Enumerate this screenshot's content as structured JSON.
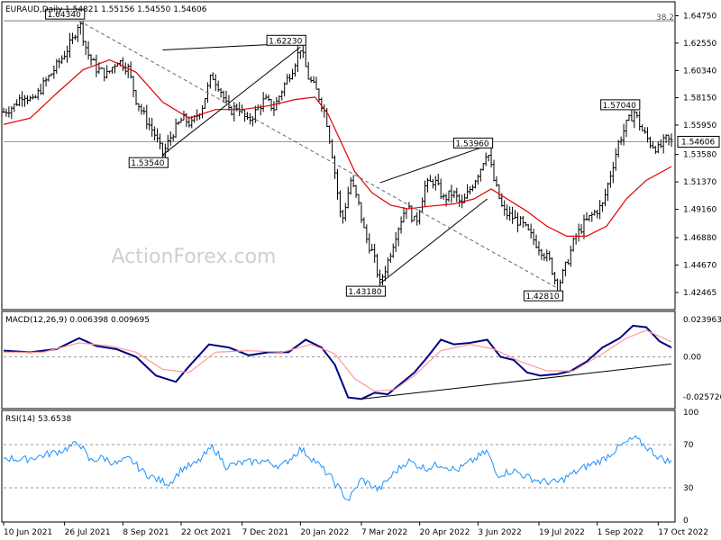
{
  "header": {
    "main_title": "EURAUD,Daily",
    "main_ohlc": "1.54821 1.55156 1.54550 1.54606",
    "macd_title": "MACD(12,26,9) 0.006398 0.009695",
    "rsi_title": "RSI(14) 53.6538",
    "watermark": "ActionForex.com",
    "fib_label": "38.2"
  },
  "colors": {
    "price": "#000000",
    "ma": "#e00000",
    "macd": "#000080",
    "signal": "#ff9999",
    "rsi": "#1e90ff",
    "dashed": "#808080",
    "watermark": "#cccccc"
  },
  "chart_data": [
    {
      "type": "ohlc",
      "panel": "price",
      "ylim": [
        1.4123,
        1.6573
      ],
      "y_ticks": [
        "1.64750",
        "1.62550",
        "1.60340",
        "1.58150",
        "1.55950",
        "1.53580",
        "1.51370",
        "1.49160",
        "1.46880",
        "1.44670",
        "1.42465"
      ],
      "current_price": "1.54606",
      "x_labels": [
        "10 Jun 2021",
        "26 Jul 2021",
        "8 Sep 2021",
        "22 Oct 2021",
        "7 Dec 2021",
        "20 Jan 2022",
        "7 Mar 2022",
        "20 Apr 2022",
        "3 Jun 2022",
        "19 Jul 2022",
        "1 Sep 2022",
        "17 Oct 2022"
      ],
      "x_label_days": [
        0,
        46,
        90,
        134,
        180,
        224,
        270,
        314,
        358,
        404,
        448,
        494
      ],
      "close_path": [
        [
          0,
          1.57
        ],
        [
          8,
          1.575
        ],
        [
          15,
          1.585
        ],
        [
          22,
          1.578
        ],
        [
          30,
          1.592
        ],
        [
          38,
          1.604
        ],
        [
          45,
          1.615
        ],
        [
          52,
          1.628
        ],
        [
          57,
          1.6434
        ],
        [
          63,
          1.618
        ],
        [
          70,
          1.605
        ],
        [
          78,
          1.6
        ],
        [
          86,
          1.612
        ],
        [
          94,
          1.605
        ],
        [
          100,
          1.58
        ],
        [
          107,
          1.565
        ],
        [
          114,
          1.552
        ],
        [
          120,
          1.5354
        ],
        [
          127,
          1.552
        ],
        [
          135,
          1.565
        ],
        [
          142,
          1.56
        ],
        [
          150,
          1.575
        ],
        [
          157,
          1.6
        ],
        [
          163,
          1.59
        ],
        [
          170,
          1.57
        ],
        [
          177,
          1.575
        ],
        [
          184,
          1.562
        ],
        [
          190,
          1.57
        ],
        [
          197,
          1.58
        ],
        [
          204,
          1.573
        ],
        [
          211,
          1.59
        ],
        [
          218,
          1.605
        ],
        [
          224,
          1.622
        ],
        [
          230,
          1.598
        ],
        [
          237,
          1.585
        ],
        [
          243,
          1.568
        ],
        [
          249,
          1.53
        ],
        [
          255,
          1.48
        ],
        [
          262,
          1.515
        ],
        [
          268,
          1.495
        ],
        [
          273,
          1.47
        ],
        [
          279,
          1.455
        ],
        [
          284,
          1.4318
        ],
        [
          290,
          1.45
        ],
        [
          297,
          1.475
        ],
        [
          304,
          1.495
        ],
        [
          311,
          1.48
        ],
        [
          318,
          1.51
        ],
        [
          325,
          1.515
        ],
        [
          332,
          1.5
        ],
        [
          339,
          1.505
        ],
        [
          346,
          1.495
        ],
        [
          353,
          1.51
        ],
        [
          360,
          1.525
        ],
        [
          365,
          1.54
        ],
        [
          370,
          1.515
        ],
        [
          377,
          1.49
        ],
        [
          384,
          1.485
        ],
        [
          391,
          1.48
        ],
        [
          398,
          1.47
        ],
        [
          405,
          1.46
        ],
        [
          412,
          1.45
        ],
        [
          418,
          1.4281
        ],
        [
          425,
          1.448
        ],
        [
          431,
          1.468
        ],
        [
          438,
          1.48
        ],
        [
          445,
          1.488
        ],
        [
          452,
          1.495
        ],
        [
          458,
          1.52
        ],
        [
          464,
          1.545
        ],
        [
          470,
          1.56
        ],
        [
          476,
          1.57
        ],
        [
          482,
          1.555
        ],
        [
          488,
          1.545
        ],
        [
          494,
          1.54
        ],
        [
          500,
          1.548
        ],
        [
          504,
          1.546
        ]
      ],
      "ma_path": [
        [
          0,
          1.56
        ],
        [
          20,
          1.565
        ],
        [
          40,
          1.585
        ],
        [
          60,
          1.604
        ],
        [
          80,
          1.612
        ],
        [
          100,
          1.602
        ],
        [
          120,
          1.578
        ],
        [
          140,
          1.565
        ],
        [
          160,
          1.572
        ],
        [
          180,
          1.572
        ],
        [
          200,
          1.575
        ],
        [
          220,
          1.58
        ],
        [
          235,
          1.582
        ],
        [
          245,
          1.568
        ],
        [
          255,
          1.545
        ],
        [
          265,
          1.522
        ],
        [
          278,
          1.505
        ],
        [
          292,
          1.495
        ],
        [
          305,
          1.492
        ],
        [
          320,
          1.494
        ],
        [
          340,
          1.496
        ],
        [
          355,
          1.5
        ],
        [
          368,
          1.508
        ],
        [
          380,
          1.5
        ],
        [
          395,
          1.49
        ],
        [
          410,
          1.478
        ],
        [
          425,
          1.47
        ],
        [
          440,
          1.47
        ],
        [
          455,
          1.478
        ],
        [
          470,
          1.5
        ],
        [
          485,
          1.515
        ],
        [
          504,
          1.526
        ]
      ],
      "levels": [
        {
          "label": "1.64340",
          "day": 57,
          "value": 1.6434,
          "pos": "top"
        },
        {
          "label": "1.62230",
          "day": 224,
          "value": 1.6223,
          "pos": "top"
        },
        {
          "label": "1.53540",
          "day": 120,
          "value": 1.5354,
          "pos": "bottom"
        },
        {
          "label": "1.43180",
          "day": 284,
          "value": 1.4318,
          "pos": "bottom"
        },
        {
          "label": "1.53960",
          "day": 365,
          "value": 1.5396,
          "pos": "top"
        },
        {
          "label": "1.42810",
          "day": 418,
          "value": 1.4281,
          "pos": "bottom"
        },
        {
          "label": "1.57040",
          "day": 476,
          "value": 1.5704,
          "pos": "top"
        }
      ],
      "trendlines": [
        {
          "style": "solid",
          "from": [
            120,
            1.5354
          ],
          "to": [
            224,
            1.6223
          ],
          "kind": "lower"
        },
        {
          "style": "solid",
          "from": [
            120,
            1.62
          ],
          "to": [
            224,
            1.6255
          ],
          "kind": "upper"
        },
        {
          "style": "solid",
          "from": [
            284,
            1.4318
          ],
          "to": [
            365,
            1.5
          ]
        },
        {
          "style": "solid",
          "from": [
            284,
            1.513
          ],
          "to": [
            365,
            1.543
          ]
        },
        {
          "style": "dashed",
          "from": [
            57,
            1.6434
          ],
          "to": [
            418,
            1.4281
          ]
        }
      ],
      "fib_level": 1.6434
    },
    {
      "type": "line",
      "panel": "macd",
      "ylim": [
        -0.032,
        0.028
      ],
      "y_ticks": [
        "0.023963",
        "0.00",
        "-0.025726"
      ],
      "series": [
        {
          "name": "MACD",
          "path": [
            [
              0,
              0.004
            ],
            [
              20,
              0.003
            ],
            [
              40,
              0.005
            ],
            [
              57,
              0.012
            ],
            [
              70,
              0.007
            ],
            [
              85,
              0.005
            ],
            [
              100,
              0.0
            ],
            [
              115,
              -0.012
            ],
            [
              130,
              -0.016
            ],
            [
              140,
              -0.006
            ],
            [
              155,
              0.008
            ],
            [
              170,
              0.006
            ],
            [
              185,
              0.001
            ],
            [
              200,
              0.003
            ],
            [
              215,
              0.003
            ],
            [
              228,
              0.011
            ],
            [
              240,
              0.006
            ],
            [
              250,
              -0.005
            ],
            [
              260,
              -0.026
            ],
            [
              270,
              -0.027
            ],
            [
              280,
              -0.023
            ],
            [
              290,
              -0.024
            ],
            [
              300,
              -0.017
            ],
            [
              310,
              -0.01
            ],
            [
              320,
              0.0
            ],
            [
              330,
              0.011
            ],
            [
              340,
              0.008
            ],
            [
              352,
              0.009
            ],
            [
              365,
              0.011
            ],
            [
              375,
              0.0
            ],
            [
              385,
              -0.002
            ],
            [
              395,
              -0.01
            ],
            [
              405,
              -0.012
            ],
            [
              418,
              -0.011
            ],
            [
              428,
              -0.009
            ],
            [
              440,
              -0.003
            ],
            [
              452,
              0.006
            ],
            [
              465,
              0.012
            ],
            [
              475,
              0.02
            ],
            [
              485,
              0.019
            ],
            [
              495,
              0.01
            ],
            [
              504,
              0.006
            ]
          ]
        },
        {
          "name": "Signal",
          "path": [
            [
              0,
              0.003
            ],
            [
              30,
              0.003
            ],
            [
              57,
              0.009
            ],
            [
              80,
              0.007
            ],
            [
              100,
              0.003
            ],
            [
              120,
              -0.008
            ],
            [
              140,
              -0.01
            ],
            [
              160,
              0.003
            ],
            [
              185,
              0.004
            ],
            [
              210,
              0.003
            ],
            [
              232,
              0.008
            ],
            [
              250,
              0.002
            ],
            [
              265,
              -0.014
            ],
            [
              280,
              -0.022
            ],
            [
              295,
              -0.021
            ],
            [
              310,
              -0.012
            ],
            [
              330,
              0.004
            ],
            [
              352,
              0.008
            ],
            [
              370,
              0.005
            ],
            [
              390,
              -0.003
            ],
            [
              410,
              -0.009
            ],
            [
              430,
              -0.009
            ],
            [
              450,
              0.001
            ],
            [
              470,
              0.012
            ],
            [
              485,
              0.017
            ],
            [
              504,
              0.0097
            ]
          ]
        }
      ],
      "trendline": {
        "from": [
          270,
          -0.027
        ],
        "to": [
          504,
          -0.0045
        ]
      }
    },
    {
      "type": "line",
      "panel": "rsi",
      "ylim": [
        0,
        100
      ],
      "y_ticks": [
        "100",
        "70",
        "30",
        "0"
      ],
      "guides": [
        70,
        30
      ],
      "series": [
        {
          "name": "RSI",
          "path": [
            [
              0,
              58
            ],
            [
              15,
              56
            ],
            [
              30,
              60
            ],
            [
              45,
              65
            ],
            [
              57,
              72
            ],
            [
              65,
              55
            ],
            [
              75,
              58
            ],
            [
              85,
              52
            ],
            [
              95,
              57
            ],
            [
              105,
              45
            ],
            [
              115,
              38
            ],
            [
              125,
              34
            ],
            [
              135,
              48
            ],
            [
              145,
              52
            ],
            [
              158,
              68
            ],
            [
              168,
              50
            ],
            [
              180,
              53
            ],
            [
              195,
              55
            ],
            [
              210,
              50
            ],
            [
              224,
              66
            ],
            [
              235,
              55
            ],
            [
              248,
              38
            ],
            [
              260,
              18
            ],
            [
              270,
              38
            ],
            [
              283,
              28
            ],
            [
              295,
              44
            ],
            [
              305,
              55
            ],
            [
              318,
              48
            ],
            [
              330,
              52
            ],
            [
              342,
              46
            ],
            [
              355,
              56
            ],
            [
              365,
              64
            ],
            [
              372,
              42
            ],
            [
              385,
              46
            ],
            [
              395,
              40
            ],
            [
              405,
              36
            ],
            [
              418,
              35
            ],
            [
              428,
              42
            ],
            [
              440,
              50
            ],
            [
              452,
              56
            ],
            [
              465,
              68
            ],
            [
              476,
              76
            ],
            [
              485,
              68
            ],
            [
              495,
              58
            ],
            [
              504,
              53.65
            ]
          ]
        }
      ]
    }
  ]
}
